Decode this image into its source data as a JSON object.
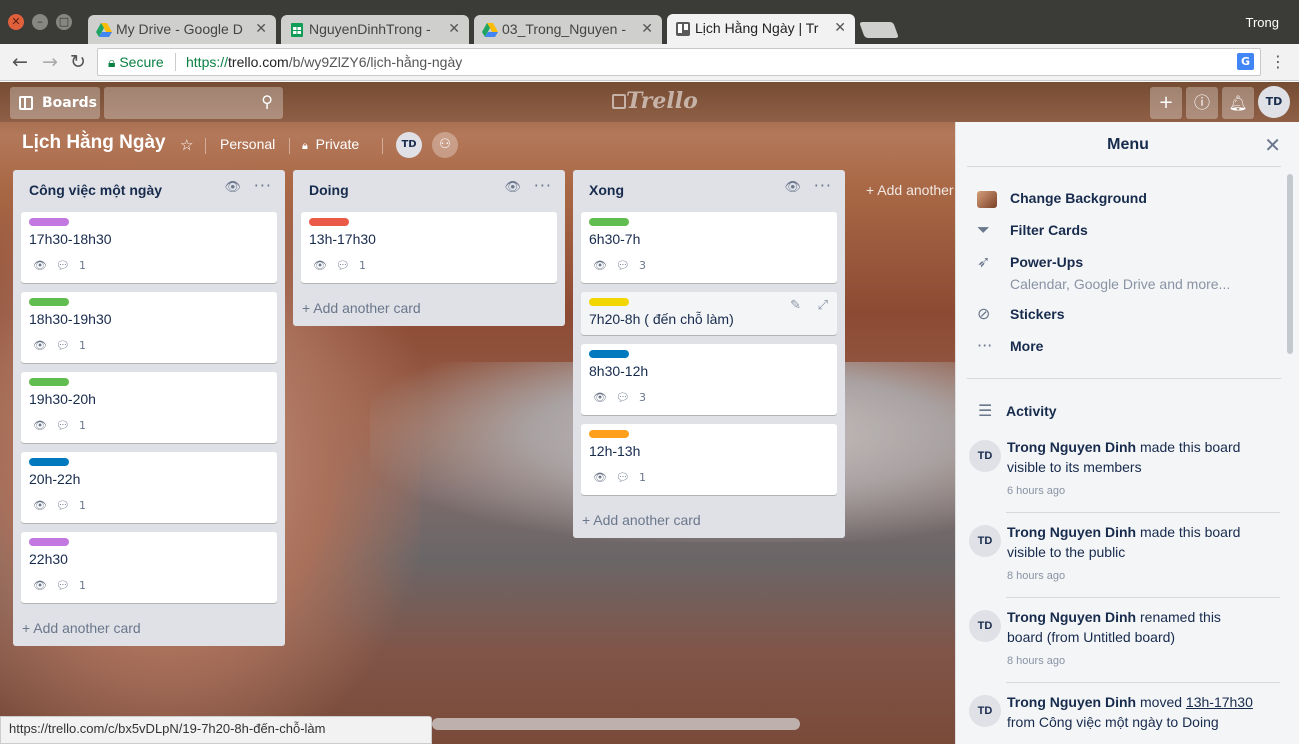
{
  "browser": {
    "tabs": [
      {
        "title": "My Drive - Google D",
        "icon": "google-drive-icon"
      },
      {
        "title": "NguyenDinhTrong -",
        "icon": "google-sheets-icon"
      },
      {
        "title": "03_Trong_Nguyen -",
        "icon": "google-drive-icon"
      },
      {
        "title": "Lịch Hằng Ngày | Tr",
        "icon": "trello-icon",
        "active": true
      }
    ],
    "user": "Trong",
    "secure_label": "Secure",
    "url_scheme": "https://",
    "url_host": "trello.com",
    "url_path": "/b/wy9ZlZY6/lịch-hằng-ngày",
    "status_url": "https://trello.com/c/bx5vDLpN/19-7h20-8h-đến-chỗ-làm"
  },
  "header": {
    "boards_label": "Boards",
    "logo": "Trello",
    "user_initials": "TD"
  },
  "board": {
    "title": "Lịch Hằng Ngày",
    "team": "Personal",
    "visibility": "Private",
    "member_initials": "TD",
    "add_list": "+ Add another list"
  },
  "lists": [
    {
      "title": "Công việc một ngày",
      "add_card": "+ Add another card",
      "cards": [
        {
          "label_color": "#c377e0",
          "title": "17h30-18h30",
          "comments": "1"
        },
        {
          "label_color": "#61bd4f",
          "title": "18h30-19h30",
          "comments": "1"
        },
        {
          "label_color": "#61bd4f",
          "title": "19h30-20h",
          "comments": "1"
        },
        {
          "label_color": "#0079bf",
          "title": "20h-22h",
          "comments": "1"
        },
        {
          "label_color": "#c377e0",
          "title": "22h30",
          "comments": "1"
        }
      ]
    },
    {
      "title": "Doing",
      "add_card": "+ Add another card",
      "cards": [
        {
          "label_color": "#eb5a46",
          "title": "13h-17h30",
          "comments": "1"
        }
      ]
    },
    {
      "title": "Xong",
      "add_card": "+ Add another card",
      "cards": [
        {
          "label_color": "#61bd4f",
          "title": "6h30-7h",
          "comments": "3"
        },
        {
          "label_color": "#f2d600",
          "title": "7h20-8h ( đến chỗ làm)",
          "comments": ""
        },
        {
          "label_color": "#0079bf",
          "title": "8h30-12h",
          "comments": "3"
        },
        {
          "label_color": "#ff9f1a",
          "title": "12h-13h",
          "comments": "1"
        }
      ]
    }
  ],
  "menu": {
    "title": "Menu",
    "items": {
      "change_background": "Change Background",
      "filter_cards": "Filter Cards",
      "power_ups": "Power-Ups",
      "power_ups_sub": "Calendar, Google Drive and more...",
      "stickers": "Stickers",
      "more": "More"
    },
    "activity_title": "Activity",
    "activities": [
      {
        "initials": "TD",
        "actor": "Trong Nguyen Dinh",
        "line1": " made this board",
        "line2": "visible to its members",
        "time": "6 hours ago"
      },
      {
        "initials": "TD",
        "actor": "Trong Nguyen Dinh",
        "line1": " made this board",
        "line2": "visible to the public",
        "time": "8 hours ago"
      },
      {
        "initials": "TD",
        "actor": "Trong Nguyen Dinh",
        "line1": " renamed this",
        "line2": "board (from Untitled board)",
        "time": "8 hours ago"
      },
      {
        "initials": "TD",
        "actor": "Trong Nguyen Dinh",
        "line1": " moved ",
        "link": "13h-17h30",
        "line2": "from Công việc một ngày to Doing",
        "time": ""
      }
    ]
  }
}
